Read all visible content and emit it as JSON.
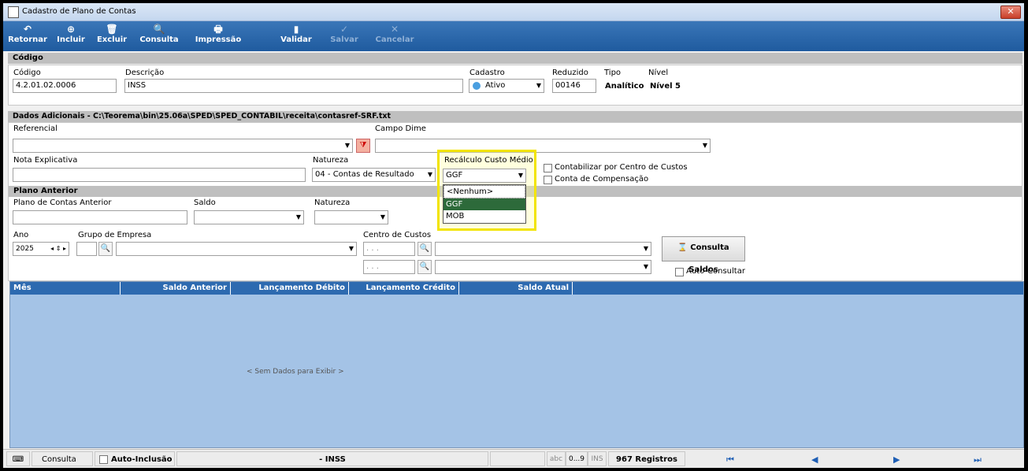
{
  "window": {
    "title": "Cadastro de Plano de Contas",
    "close": "✕"
  },
  "toolbar": [
    {
      "label": "Retornar",
      "icon": "↶"
    },
    {
      "label": "Incluir",
      "icon": "⊕"
    },
    {
      "label": "Excluir",
      "icon": "🗑"
    },
    {
      "label": "Consulta",
      "icon": "🔍"
    },
    {
      "label": "Impressão",
      "icon": "🖶"
    },
    {
      "label": "Validar",
      "icon": "▮"
    },
    {
      "label": "Salvar",
      "icon": "✓"
    },
    {
      "label": "Cancelar",
      "icon": "✕"
    }
  ],
  "codigo_section": {
    "title": "Código",
    "codigo_label": "Código",
    "codigo_value": "4.2.01.02.0006",
    "descricao_label": "Descrição",
    "descricao_value": "INSS",
    "cadastro_label": "Cadastro",
    "cadastro_value": "Ativo",
    "reduzido_label": "Reduzido",
    "reduzido_value": "00146",
    "tipo_label": "Tipo",
    "tipo_value": "Analítico",
    "nivel_label": "Nível",
    "nivel_value": "Nível 5"
  },
  "dados": {
    "title": "Dados Adicionais - C:\\Teorema\\bin\\25.06a\\SPED\\SPED_CONTABIL\\receita\\contasref-SRF.txt",
    "referencial_label": "Referencial",
    "campo_dime_label": "Campo Dime",
    "nota_label": "Nota Explicativa",
    "natureza_label": "Natureza",
    "natureza_value": "04 - Contas de Resultado",
    "recalc_label": "Recálculo Custo Médio",
    "recalc_value": "GGF",
    "recalc_options": [
      "<Nenhum>",
      "GGF",
      "MOB"
    ],
    "contabilizar_label": "Contabilizar por Centro de Custos",
    "compensacao_label": "Conta de Compensação"
  },
  "plano_anterior": {
    "title": "Plano Anterior",
    "plano_label": "Plano de Contas Anterior",
    "saldo_label": "Saldo",
    "natureza_label": "Natureza"
  },
  "filtros": {
    "ano_label": "Ano",
    "ano_value": "2025",
    "grupo_label": "Grupo de Empresa",
    "centro_label": "Centro de Custos",
    "centro_placeholder": ". . .",
    "consulta_saldos": "Consulta Saldos",
    "auto_consultar": "Auto-Consultar"
  },
  "grid": {
    "columns": [
      "Mês",
      "Saldo Anterior",
      "Lançamento Débito",
      "Lançamento Crédito",
      "Saldo Atual"
    ],
    "empty": "< Sem Dados para Exibir >"
  },
  "status": {
    "mode": "Consulta",
    "auto_inclusao": "Auto-Inclusão",
    "record": "- INSS",
    "abc": "abc",
    "num": "0...9",
    "ins": "INS",
    "count": "967 Registros",
    "nav": [
      "⏮",
      "◀",
      "▶",
      "⏭"
    ]
  }
}
